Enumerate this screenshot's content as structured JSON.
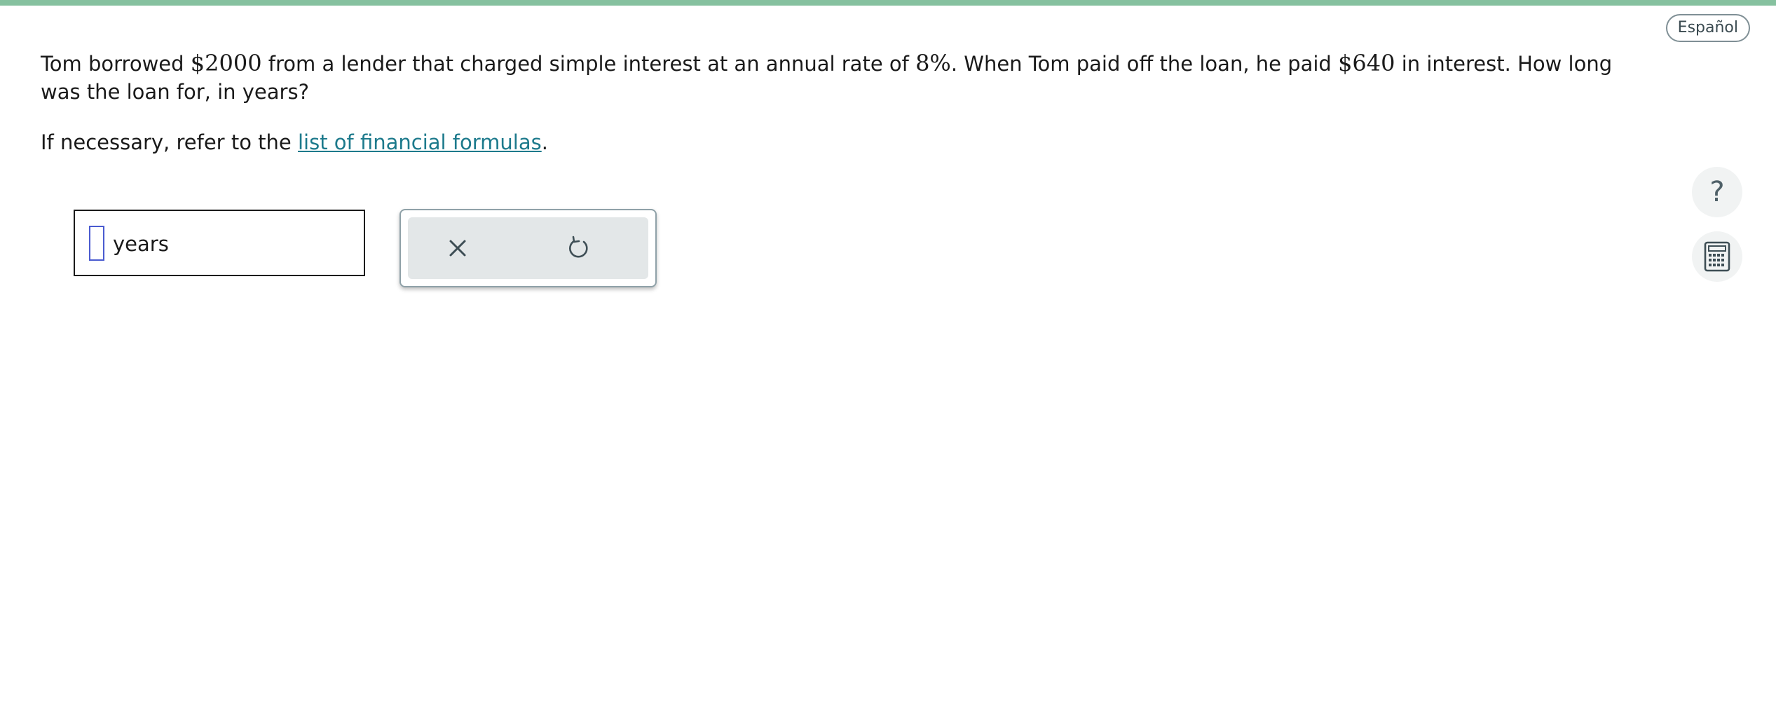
{
  "header": {
    "language_button": "Español"
  },
  "question": {
    "part1": "Tom borrowed ",
    "principal": "$2000",
    "part2": " from a lender that charged simple interest at an annual rate of ",
    "rate": "8%",
    "part3": ". When Tom paid off the loan, he paid ",
    "interest": "$640",
    "part4": " in interest. How long was the loan for, in years?"
  },
  "reference": {
    "prefix": "If necessary, refer to the ",
    "link_text": "list of financial formulas",
    "suffix": "."
  },
  "answer": {
    "value": "",
    "unit": "years"
  },
  "tools": {
    "clear_icon": "close-icon",
    "undo_icon": "undo-icon"
  },
  "side_tools": {
    "help_label": "?",
    "help_icon": "question-mark-icon",
    "calculator_icon": "calculator-icon"
  },
  "colors": {
    "accent_bar": "#86c19f",
    "link": "#1d7a8c",
    "cursor": "#4a5bd0"
  }
}
